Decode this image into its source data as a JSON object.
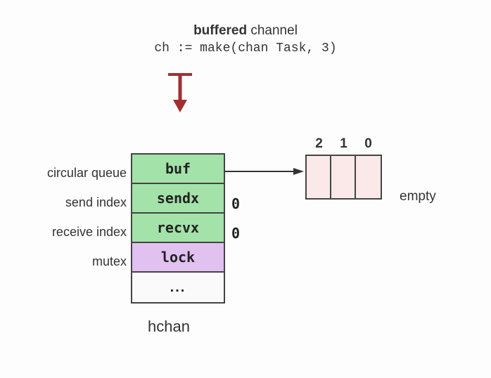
{
  "title": {
    "bold_part": "buffered",
    "rest": " channel"
  },
  "code": "ch := make(chan Task, 3)",
  "labels": {
    "buf": "circular queue",
    "sendx": "send index",
    "recvx": "receive index",
    "lock": "mutex"
  },
  "struct": {
    "buf": "buf",
    "sendx": "sendx",
    "recvx": "recvx",
    "lock": "lock",
    "more": "..."
  },
  "indices": {
    "sendx_val": "0",
    "recvx_val": "0"
  },
  "hchan_label": "hchan",
  "buffer": {
    "indices": [
      "2",
      "1",
      "0"
    ],
    "state": "empty"
  }
}
